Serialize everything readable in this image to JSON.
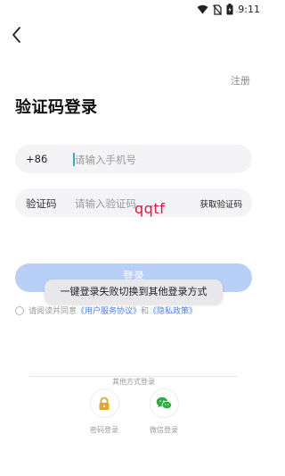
{
  "status": {
    "time": "9:11"
  },
  "header": {
    "register_label": "注册"
  },
  "page": {
    "title": "验证码登录"
  },
  "phone": {
    "country_code": "+86",
    "placeholder": "请输入手机号"
  },
  "code": {
    "label": "验证码",
    "placeholder": "请输入验证码",
    "get_code_label": "获取验证码"
  },
  "overlay_text": "qqtf",
  "login": {
    "label": "登录"
  },
  "agreement": {
    "prefix": "请阅读并同意",
    "user_agreement": "《用户服务协议》",
    "and": "和",
    "privacy_policy": "《隐私政策》"
  },
  "toast": {
    "message": "一键登录失败切换到其他登录方式"
  },
  "other_methods": {
    "label": "其他方式登录",
    "password_login": "密码登录",
    "wechat_login": "微信登录"
  },
  "colors": {
    "accent": "#b8d0f7",
    "link": "#4a7ff0",
    "wechat": "#2bae3a",
    "lock": "#e2a531",
    "overlay": "#e8113e"
  },
  "icons": [
    "wifi-icon",
    "no-sim-icon",
    "battery-icon",
    "back-arrow-icon",
    "lock-icon",
    "wechat-icon"
  ]
}
